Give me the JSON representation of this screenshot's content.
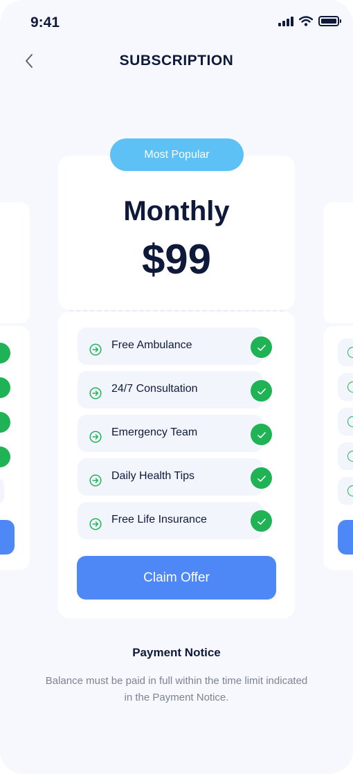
{
  "status_bar": {
    "time": "9:41"
  },
  "header": {
    "title": "SUBSCRIPTION"
  },
  "plan": {
    "badge": "Most Popular",
    "name": "Monthly",
    "price": "$99",
    "features": [
      {
        "label": "Free Ambulance"
      },
      {
        "label": "24/7 Consultation"
      },
      {
        "label": "Emergency Team"
      },
      {
        "label": "Daily Health Tips"
      },
      {
        "label": "Free Life Insurance"
      }
    ],
    "cta": "Claim Offer"
  },
  "notice": {
    "title": "Payment Notice",
    "body": "Balance must be paid in full within the time limit indicated in the Payment Notice."
  },
  "colors": {
    "background": "#f6f8fe",
    "accent_blue": "#4e88f7",
    "badge_blue": "#5ec1f5",
    "check_green": "#1fb356",
    "text_dark": "#0f1a3a",
    "text_muted": "#7b8394"
  }
}
